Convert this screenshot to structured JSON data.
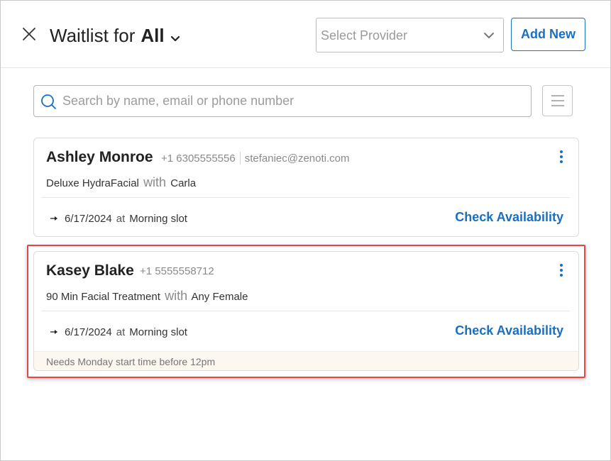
{
  "header": {
    "title_prefix": "Waitlist for",
    "title_scope": "All",
    "provider_placeholder": "Select Provider",
    "add_new_label": "Add New"
  },
  "search": {
    "placeholder": "Search by name, email or phone number"
  },
  "cards": [
    {
      "name": "Ashley Monroe",
      "phone": "+1 6305555556",
      "email": "stefaniec@zenoti.com",
      "service": "Deluxe HydraFacial",
      "with_label": "with",
      "provider": "Carla",
      "date": "6/17/2024",
      "at_label": "at",
      "slot": "Morning slot",
      "action_label": "Check Availability"
    },
    {
      "name": "Kasey Blake",
      "phone": "+1 5555558712",
      "service": "90 Min Facial Treatment",
      "with_label": "with",
      "provider": "Any Female",
      "date": "6/17/2024",
      "at_label": "at",
      "slot": "Morning slot",
      "action_label": "Check Availability",
      "note": "Needs Monday start time before 12pm"
    }
  ],
  "colors": {
    "accent": "#1a6fc1",
    "highlight": "#e54545",
    "note_background": "#fcf7ef"
  },
  "icons": [
    "close-icon",
    "chevron-down-icon",
    "search-icon",
    "hamburger-menu-icon",
    "kebab-menu-icon",
    "arrow-right-icon"
  ]
}
